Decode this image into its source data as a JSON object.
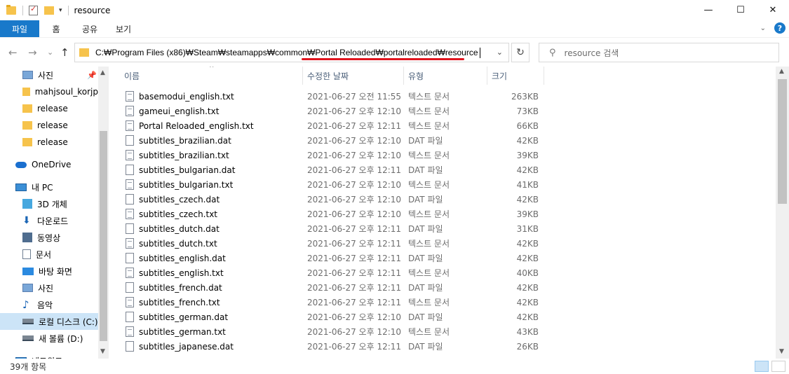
{
  "window": {
    "title": "resource",
    "minimize": "—",
    "maximize": "☐",
    "close": "✕"
  },
  "ribbon": {
    "tabs": [
      "파일",
      "홈",
      "공유",
      "보기"
    ],
    "help": "?",
    "expand": "⌄"
  },
  "nav": {
    "back": "←",
    "forward": "→",
    "recent": "⌄",
    "up": "↑",
    "address": "C:₩Program Files (x86)₩Steam₩steamapps₩common₩Portal Reloaded₩portalreloaded₩resource",
    "address_dropdown": "⌄",
    "refresh": "↻",
    "search_icon": "⚲",
    "search_placeholder": "resource 검색"
  },
  "sidebar": {
    "items": [
      {
        "label": "사진",
        "icon": "pictures-icon",
        "pinned": true
      },
      {
        "label": "mahjsoul_korjp",
        "icon": "folder-icon"
      },
      {
        "label": "release",
        "icon": "folder-icon"
      },
      {
        "label": "release",
        "icon": "folder-icon"
      },
      {
        "label": "release",
        "icon": "folder-icon"
      },
      {
        "label": "OneDrive",
        "icon": "onedrive-icon"
      },
      {
        "label": "내 PC",
        "icon": "pc-icon"
      },
      {
        "label": "3D 개체",
        "icon": "3d-objects-icon"
      },
      {
        "label": "다운로드",
        "icon": "download-icon"
      },
      {
        "label": "동영상",
        "icon": "video-icon"
      },
      {
        "label": "문서",
        "icon": "document-icon"
      },
      {
        "label": "바탕 화면",
        "icon": "desktop-icon"
      },
      {
        "label": "사진",
        "icon": "pictures-icon"
      },
      {
        "label": "음악",
        "icon": "music-icon"
      },
      {
        "label": "로컬 디스크 (C:)",
        "icon": "drive-icon",
        "selected": true
      },
      {
        "label": "새 볼륨 (D:)",
        "icon": "drive-icon"
      },
      {
        "label": "네트워크",
        "icon": "network-icon"
      }
    ]
  },
  "columns": {
    "name": "이름",
    "date": "수정한 날짜",
    "type": "유형",
    "size": "크기"
  },
  "files": [
    {
      "name": "basemodui_english.txt",
      "date": "2021-06-27 오전 11:55",
      "type": "텍스트 문서",
      "size": "263KB",
      "kind": "txt"
    },
    {
      "name": "gameui_english.txt",
      "date": "2021-06-27 오후 12:10",
      "type": "텍스트 문서",
      "size": "73KB",
      "kind": "txt"
    },
    {
      "name": "Portal Reloaded_english.txt",
      "date": "2021-06-27 오후 12:11",
      "type": "텍스트 문서",
      "size": "66KB",
      "kind": "txt"
    },
    {
      "name": "subtitles_brazilian.dat",
      "date": "2021-06-27 오후 12:10",
      "type": "DAT 파일",
      "size": "42KB",
      "kind": "dat"
    },
    {
      "name": "subtitles_brazilian.txt",
      "date": "2021-06-27 오후 12:10",
      "type": "텍스트 문서",
      "size": "39KB",
      "kind": "txt"
    },
    {
      "name": "subtitles_bulgarian.dat",
      "date": "2021-06-27 오후 12:11",
      "type": "DAT 파일",
      "size": "42KB",
      "kind": "dat"
    },
    {
      "name": "subtitles_bulgarian.txt",
      "date": "2021-06-27 오후 12:10",
      "type": "텍스트 문서",
      "size": "41KB",
      "kind": "txt"
    },
    {
      "name": "subtitles_czech.dat",
      "date": "2021-06-27 오후 12:10",
      "type": "DAT 파일",
      "size": "42KB",
      "kind": "dat"
    },
    {
      "name": "subtitles_czech.txt",
      "date": "2021-06-27 오후 12:10",
      "type": "텍스트 문서",
      "size": "39KB",
      "kind": "txt"
    },
    {
      "name": "subtitles_dutch.dat",
      "date": "2021-06-27 오후 12:11",
      "type": "DAT 파일",
      "size": "31KB",
      "kind": "dat"
    },
    {
      "name": "subtitles_dutch.txt",
      "date": "2021-06-27 오후 12:11",
      "type": "텍스트 문서",
      "size": "42KB",
      "kind": "txt"
    },
    {
      "name": "subtitles_english.dat",
      "date": "2021-06-27 오후 12:11",
      "type": "DAT 파일",
      "size": "42KB",
      "kind": "dat"
    },
    {
      "name": "subtitles_english.txt",
      "date": "2021-06-27 오후 12:11",
      "type": "텍스트 문서",
      "size": "40KB",
      "kind": "txt"
    },
    {
      "name": "subtitles_french.dat",
      "date": "2021-06-27 오후 12:11",
      "type": "DAT 파일",
      "size": "42KB",
      "kind": "dat"
    },
    {
      "name": "subtitles_french.txt",
      "date": "2021-06-27 오후 12:11",
      "type": "텍스트 문서",
      "size": "42KB",
      "kind": "txt"
    },
    {
      "name": "subtitles_german.dat",
      "date": "2021-06-27 오후 12:10",
      "type": "DAT 파일",
      "size": "42KB",
      "kind": "dat"
    },
    {
      "name": "subtitles_german.txt",
      "date": "2021-06-27 오후 12:10",
      "type": "텍스트 문서",
      "size": "43KB",
      "kind": "txt"
    },
    {
      "name": "subtitles_japanese.dat",
      "date": "2021-06-27 오후 12:11",
      "type": "DAT 파일",
      "size": "26KB",
      "kind": "dat"
    }
  ],
  "status": {
    "item_count": "39개 항목"
  },
  "colors": {
    "accent": "#1979ca",
    "selection": "#cce4f7",
    "highlight_underline": "#e0141e"
  }
}
